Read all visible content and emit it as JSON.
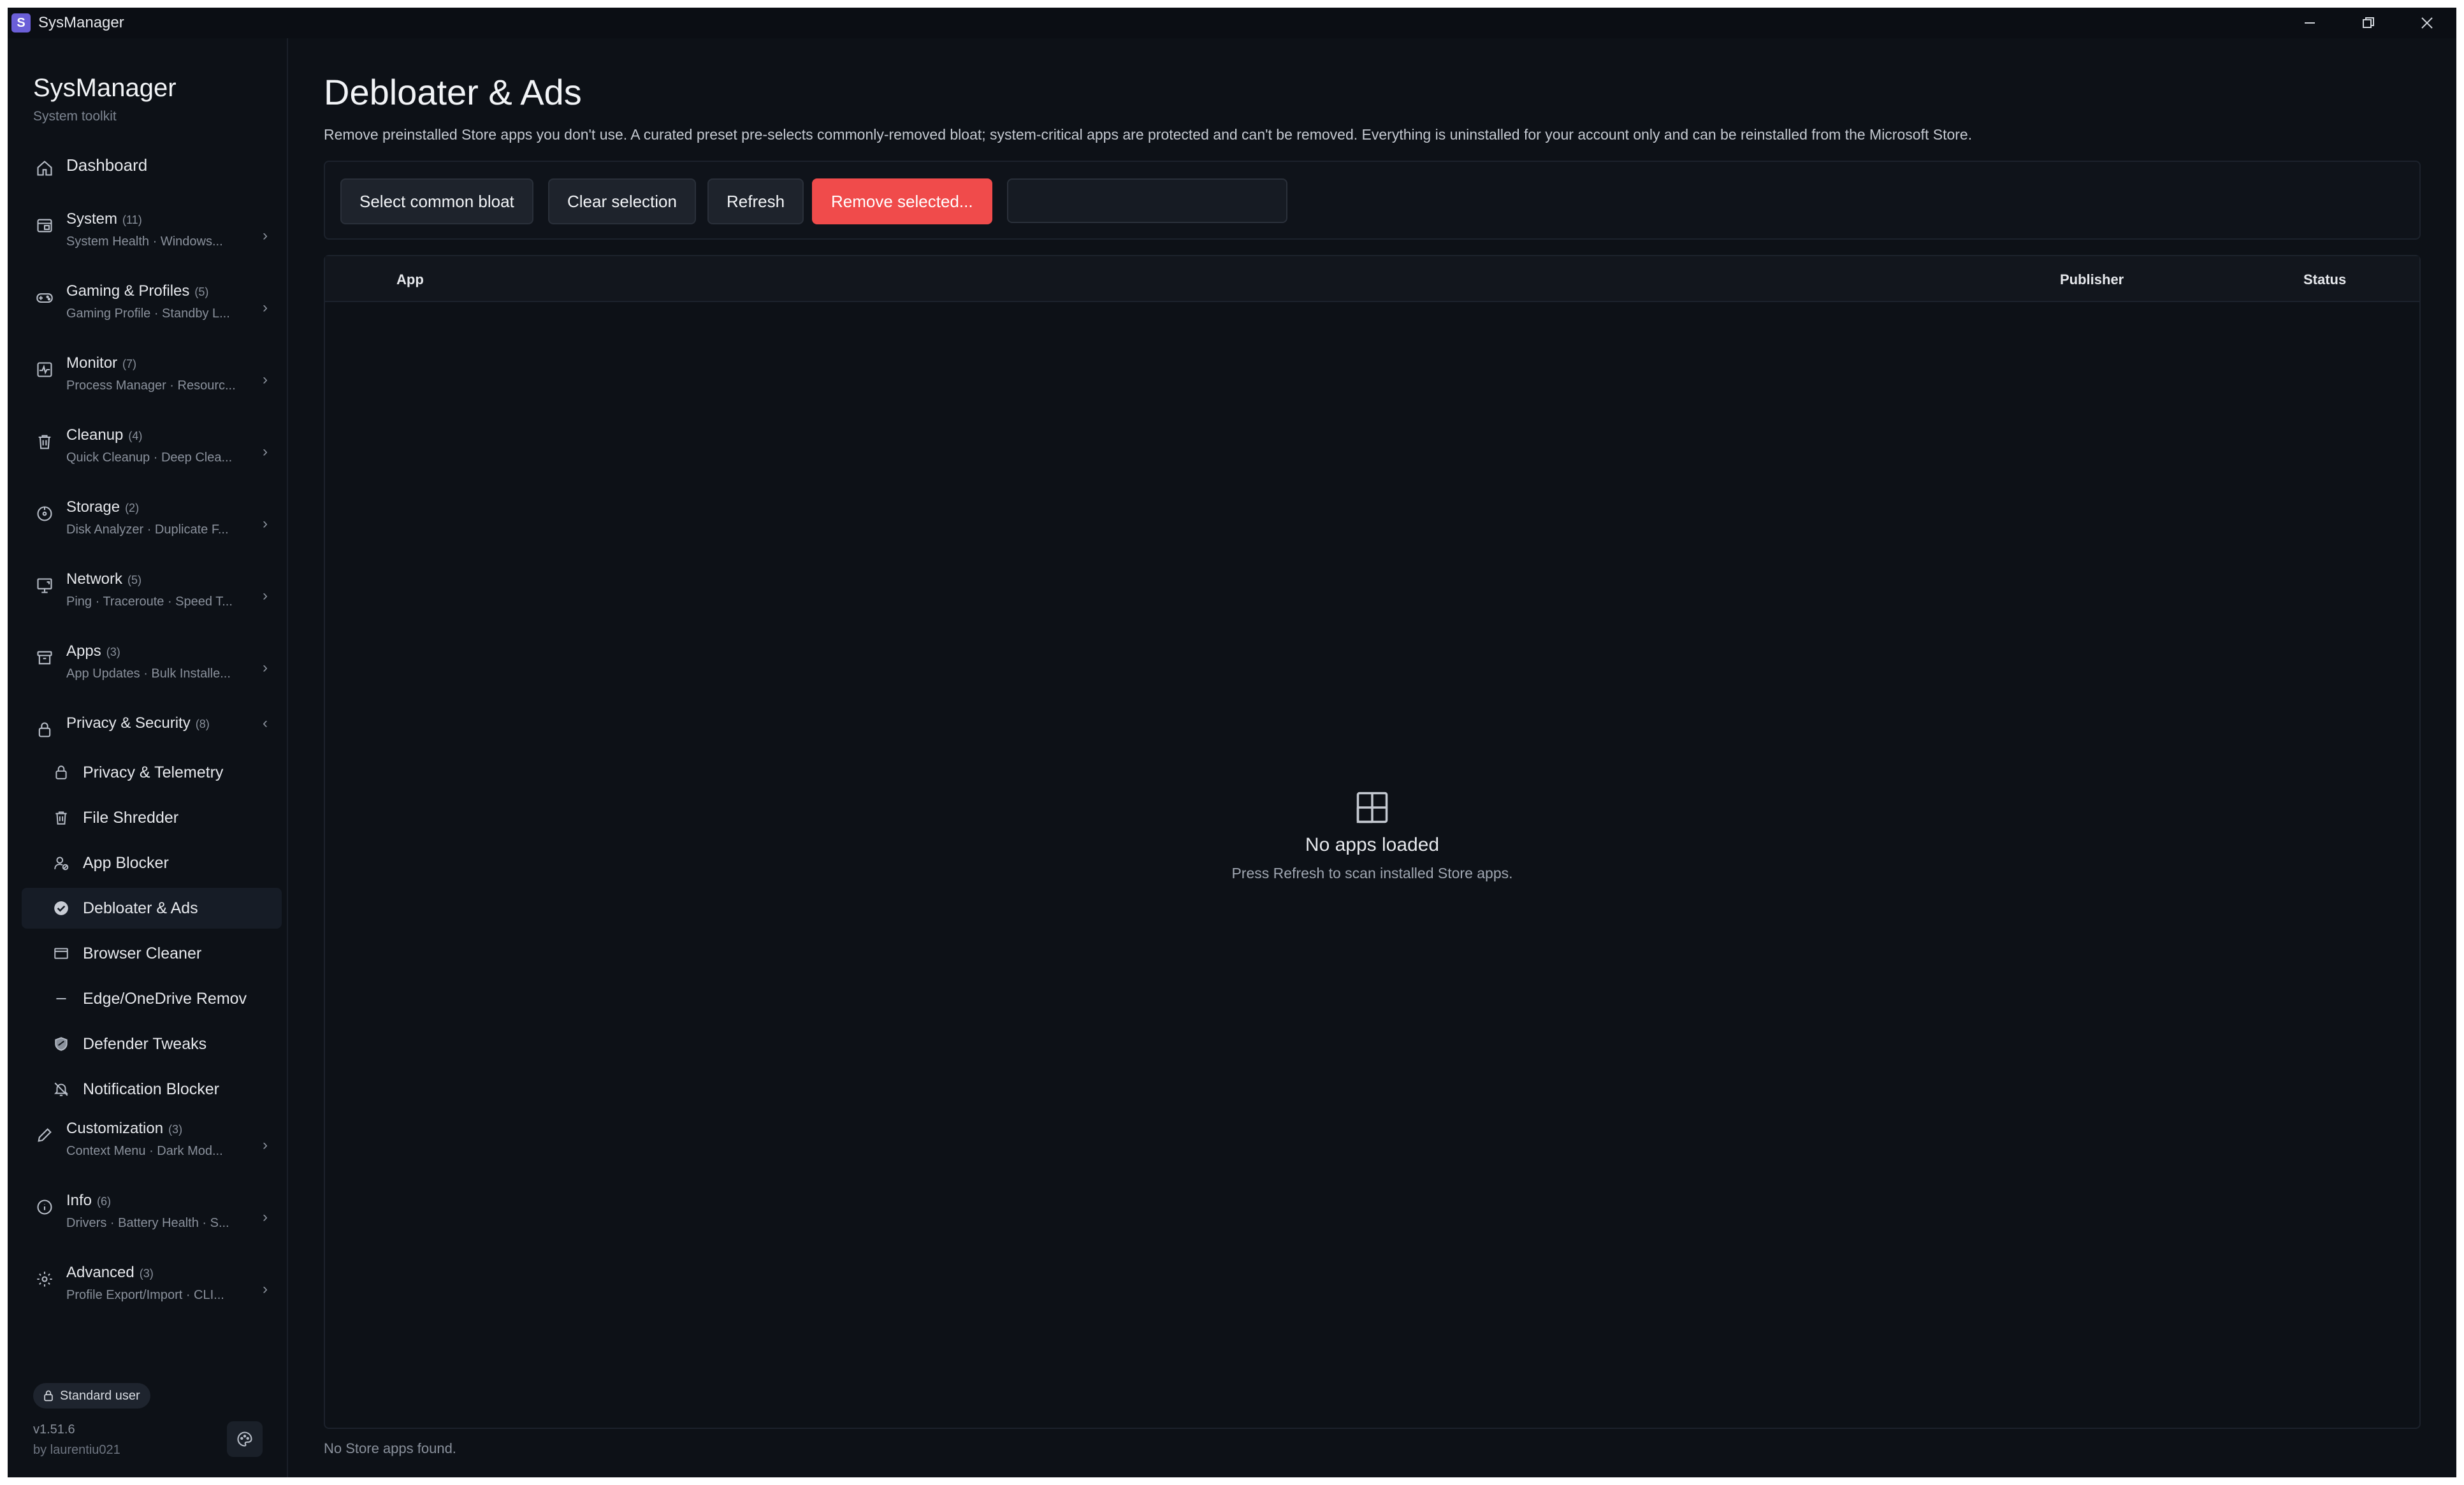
{
  "window": {
    "title": "SysManager",
    "app_icon_letter": "S"
  },
  "brand": {
    "title": "SysManager",
    "subtitle": "System toolkit"
  },
  "nav": {
    "dashboard": "Dashboard",
    "groups": [
      {
        "label": "System",
        "count": "(11)",
        "sub": "System Health · Windows..."
      },
      {
        "label": "Gaming & Profiles",
        "count": "(5)",
        "sub": "Gaming Profile · Standby L..."
      },
      {
        "label": "Monitor",
        "count": "(7)",
        "sub": "Process Manager · Resourc..."
      },
      {
        "label": "Cleanup",
        "count": "(4)",
        "sub": "Quick Cleanup · Deep Clea..."
      },
      {
        "label": "Storage",
        "count": "(2)",
        "sub": "Disk Analyzer · Duplicate F..."
      },
      {
        "label": "Network",
        "count": "(5)",
        "sub": "Ping · Traceroute · Speed T..."
      },
      {
        "label": "Apps",
        "count": "(3)",
        "sub": "App Updates · Bulk Installe..."
      },
      {
        "label": "Privacy & Security",
        "count": "(8)",
        "sub": ""
      },
      {
        "label": "Customization",
        "count": "(3)",
        "sub": "Context Menu · Dark Mod..."
      },
      {
        "label": "Info",
        "count": "(6)",
        "sub": "Drivers · Battery Health · S..."
      },
      {
        "label": "Advanced",
        "count": "(3)",
        "sub": "Profile Export/Import · CLI..."
      }
    ],
    "privacy_items": [
      "Privacy & Telemetry",
      "File Shredder",
      "App Blocker",
      "Debloater & Ads",
      "Browser Cleaner",
      "Edge/OneDrive Remov",
      "Defender Tweaks",
      "Notification Blocker"
    ]
  },
  "footer": {
    "badge": "Standard user",
    "version": "v1.51.6",
    "author": "by laurentiu021"
  },
  "page": {
    "title": "Debloater & Ads",
    "description": "Remove preinstalled Store apps you don't use. A curated preset pre-selects commonly-removed bloat; system-critical apps are protected and can't be removed. Everything is uninstalled for your account only and can be reinstalled from the Microsoft Store."
  },
  "toolbar": {
    "select_common": "Select common bloat",
    "clear_selection": "Clear selection",
    "refresh": "Refresh",
    "remove_selected": "Remove selected...",
    "search_value": ""
  },
  "table": {
    "columns": [
      "App",
      "Publisher",
      "Status"
    ]
  },
  "empty_state": {
    "title": "No apps loaded",
    "subtitle": "Press Refresh to scan installed Store apps."
  },
  "status": "No Store apps found.",
  "colors": {
    "accent_danger": "#f04b4b",
    "background": "#0d1117",
    "brand_icon": "#6b5fd8"
  }
}
